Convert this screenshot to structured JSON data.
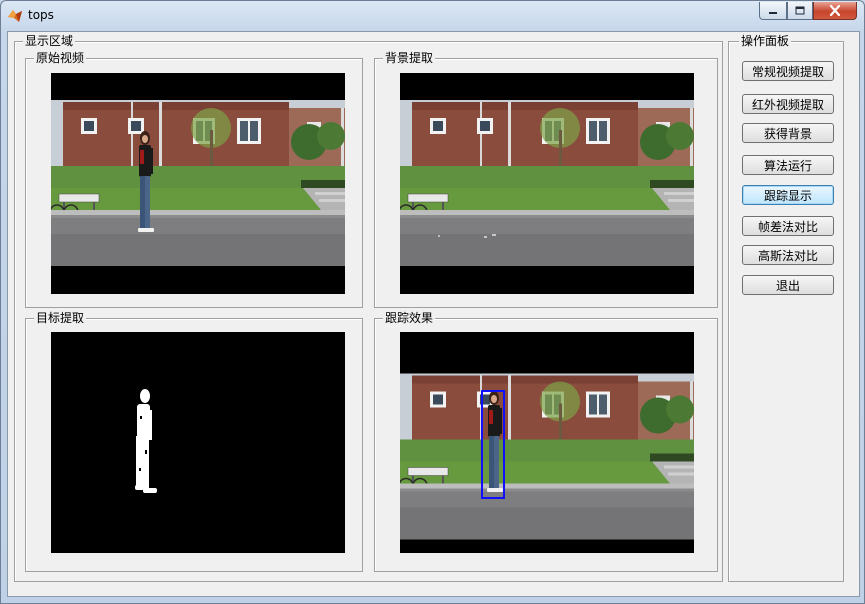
{
  "window": {
    "title": "tops"
  },
  "display_area": {
    "title": "显示区域",
    "panels": {
      "original": "原始视频",
      "background": "背景提取",
      "target": "目标提取",
      "tracking": "跟踪效果"
    }
  },
  "control_panel": {
    "title": "操作面板",
    "buttons": [
      {
        "label": "常规视频提取"
      },
      {
        "label": "红外视频提取"
      },
      {
        "label": "获得背景"
      },
      {
        "label": "算法运行"
      },
      {
        "label": "跟踪显示"
      },
      {
        "label": "帧差法对比"
      },
      {
        "label": "高斯法对比"
      },
      {
        "label": "退出"
      }
    ]
  },
  "colors": {
    "tracking_box": "#1010ff",
    "active_button": "#bee6fd"
  }
}
